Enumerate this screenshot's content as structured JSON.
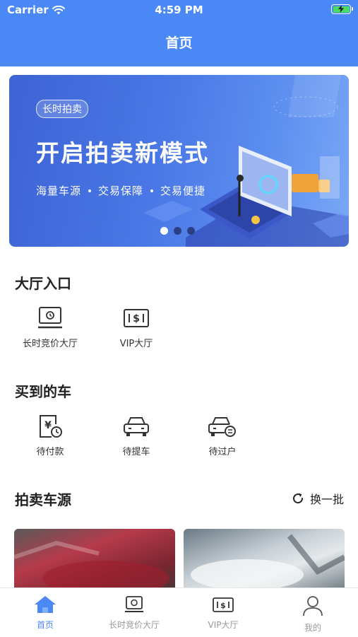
{
  "status_bar": {
    "carrier": "Carrier",
    "time": "4:59 PM"
  },
  "nav": {
    "title": "首页"
  },
  "banner": {
    "tag": "长时拍卖",
    "title": "开启拍卖新模式",
    "features": [
      "海量车源",
      "交易保障",
      "交易便捷"
    ],
    "pages": 3,
    "active_page": 1
  },
  "hall": {
    "title": "大厅入口",
    "items": [
      {
        "label": "长时竞价大厅",
        "icon": "monitor-icon"
      },
      {
        "label": "VIP大厅",
        "icon": "cash-icon"
      }
    ]
  },
  "purchased": {
    "title": "买到的车",
    "items": [
      {
        "label": "待付款",
        "icon": "pending-payment-icon"
      },
      {
        "label": "待提车",
        "icon": "car-icon"
      },
      {
        "label": "待过户",
        "icon": "car-transfer-icon"
      }
    ]
  },
  "auction": {
    "title": "拍卖车源",
    "refresh_label": "换一批"
  },
  "tabbar": {
    "active": 0,
    "items": [
      {
        "label": "首页",
        "icon": "home-icon"
      },
      {
        "label": "长时竞价大厅",
        "icon": "monitor-icon"
      },
      {
        "label": "VIP大厅",
        "icon": "cash-icon"
      },
      {
        "label": "我的",
        "icon": "user-icon"
      }
    ]
  },
  "colors": {
    "primary": "#4a89f5",
    "banner_dark": "#3d63d4",
    "text": "#222222",
    "inactive": "#999999"
  }
}
